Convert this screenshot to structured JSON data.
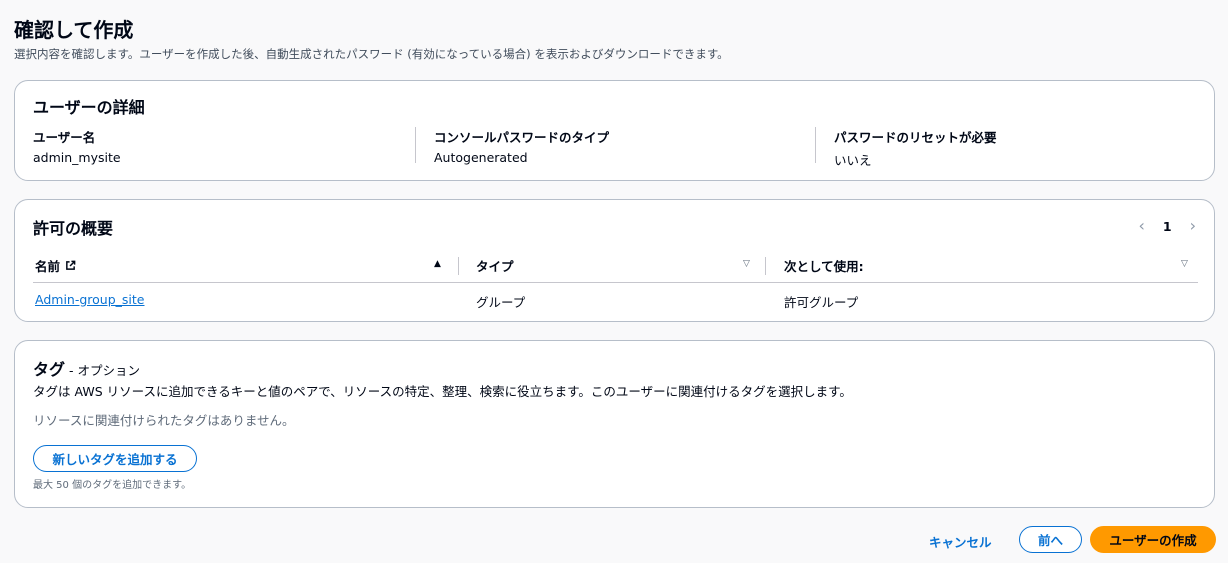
{
  "page": {
    "title": "確認して作成",
    "description": "選択内容を確認します。ユーザーを作成した後、自動生成されたパスワード (有効になっている場合) を表示およびダウンロードできます。"
  },
  "user_details": {
    "title": "ユーザーの詳細",
    "fields": [
      {
        "label": "ユーザー名",
        "value": "admin_mysite"
      },
      {
        "label": "コンソールパスワードのタイプ",
        "value": "Autogenerated"
      },
      {
        "label": "パスワードのリセットが必要",
        "value": "いいえ"
      }
    ]
  },
  "permissions": {
    "title": "許可の概要",
    "page_number": "1",
    "columns": [
      "名前",
      "タイプ",
      "次として使用:"
    ],
    "rows": [
      {
        "name": "Admin-group_site",
        "type": "グループ",
        "used_as": "許可グループ"
      }
    ]
  },
  "tags": {
    "title": "タグ",
    "optional": "- オプション",
    "description": "タグは AWS リソースに追加できるキーと値のペアで、リソースの特定、整理、検索に役立ちます。このユーザーに関連付けるタグを選択します。",
    "empty": "リソースに関連付けられたタグはありません。",
    "add_button": "新しいタグを追加する",
    "hint": "最大 50 個のタグを追加できます。"
  },
  "footer": {
    "cancel": "キャンセル",
    "previous": "前へ",
    "create": "ユーザーの作成"
  },
  "colors": {
    "primary": "#ff9900",
    "link": "#0972d3",
    "border": "#b6bec9"
  }
}
